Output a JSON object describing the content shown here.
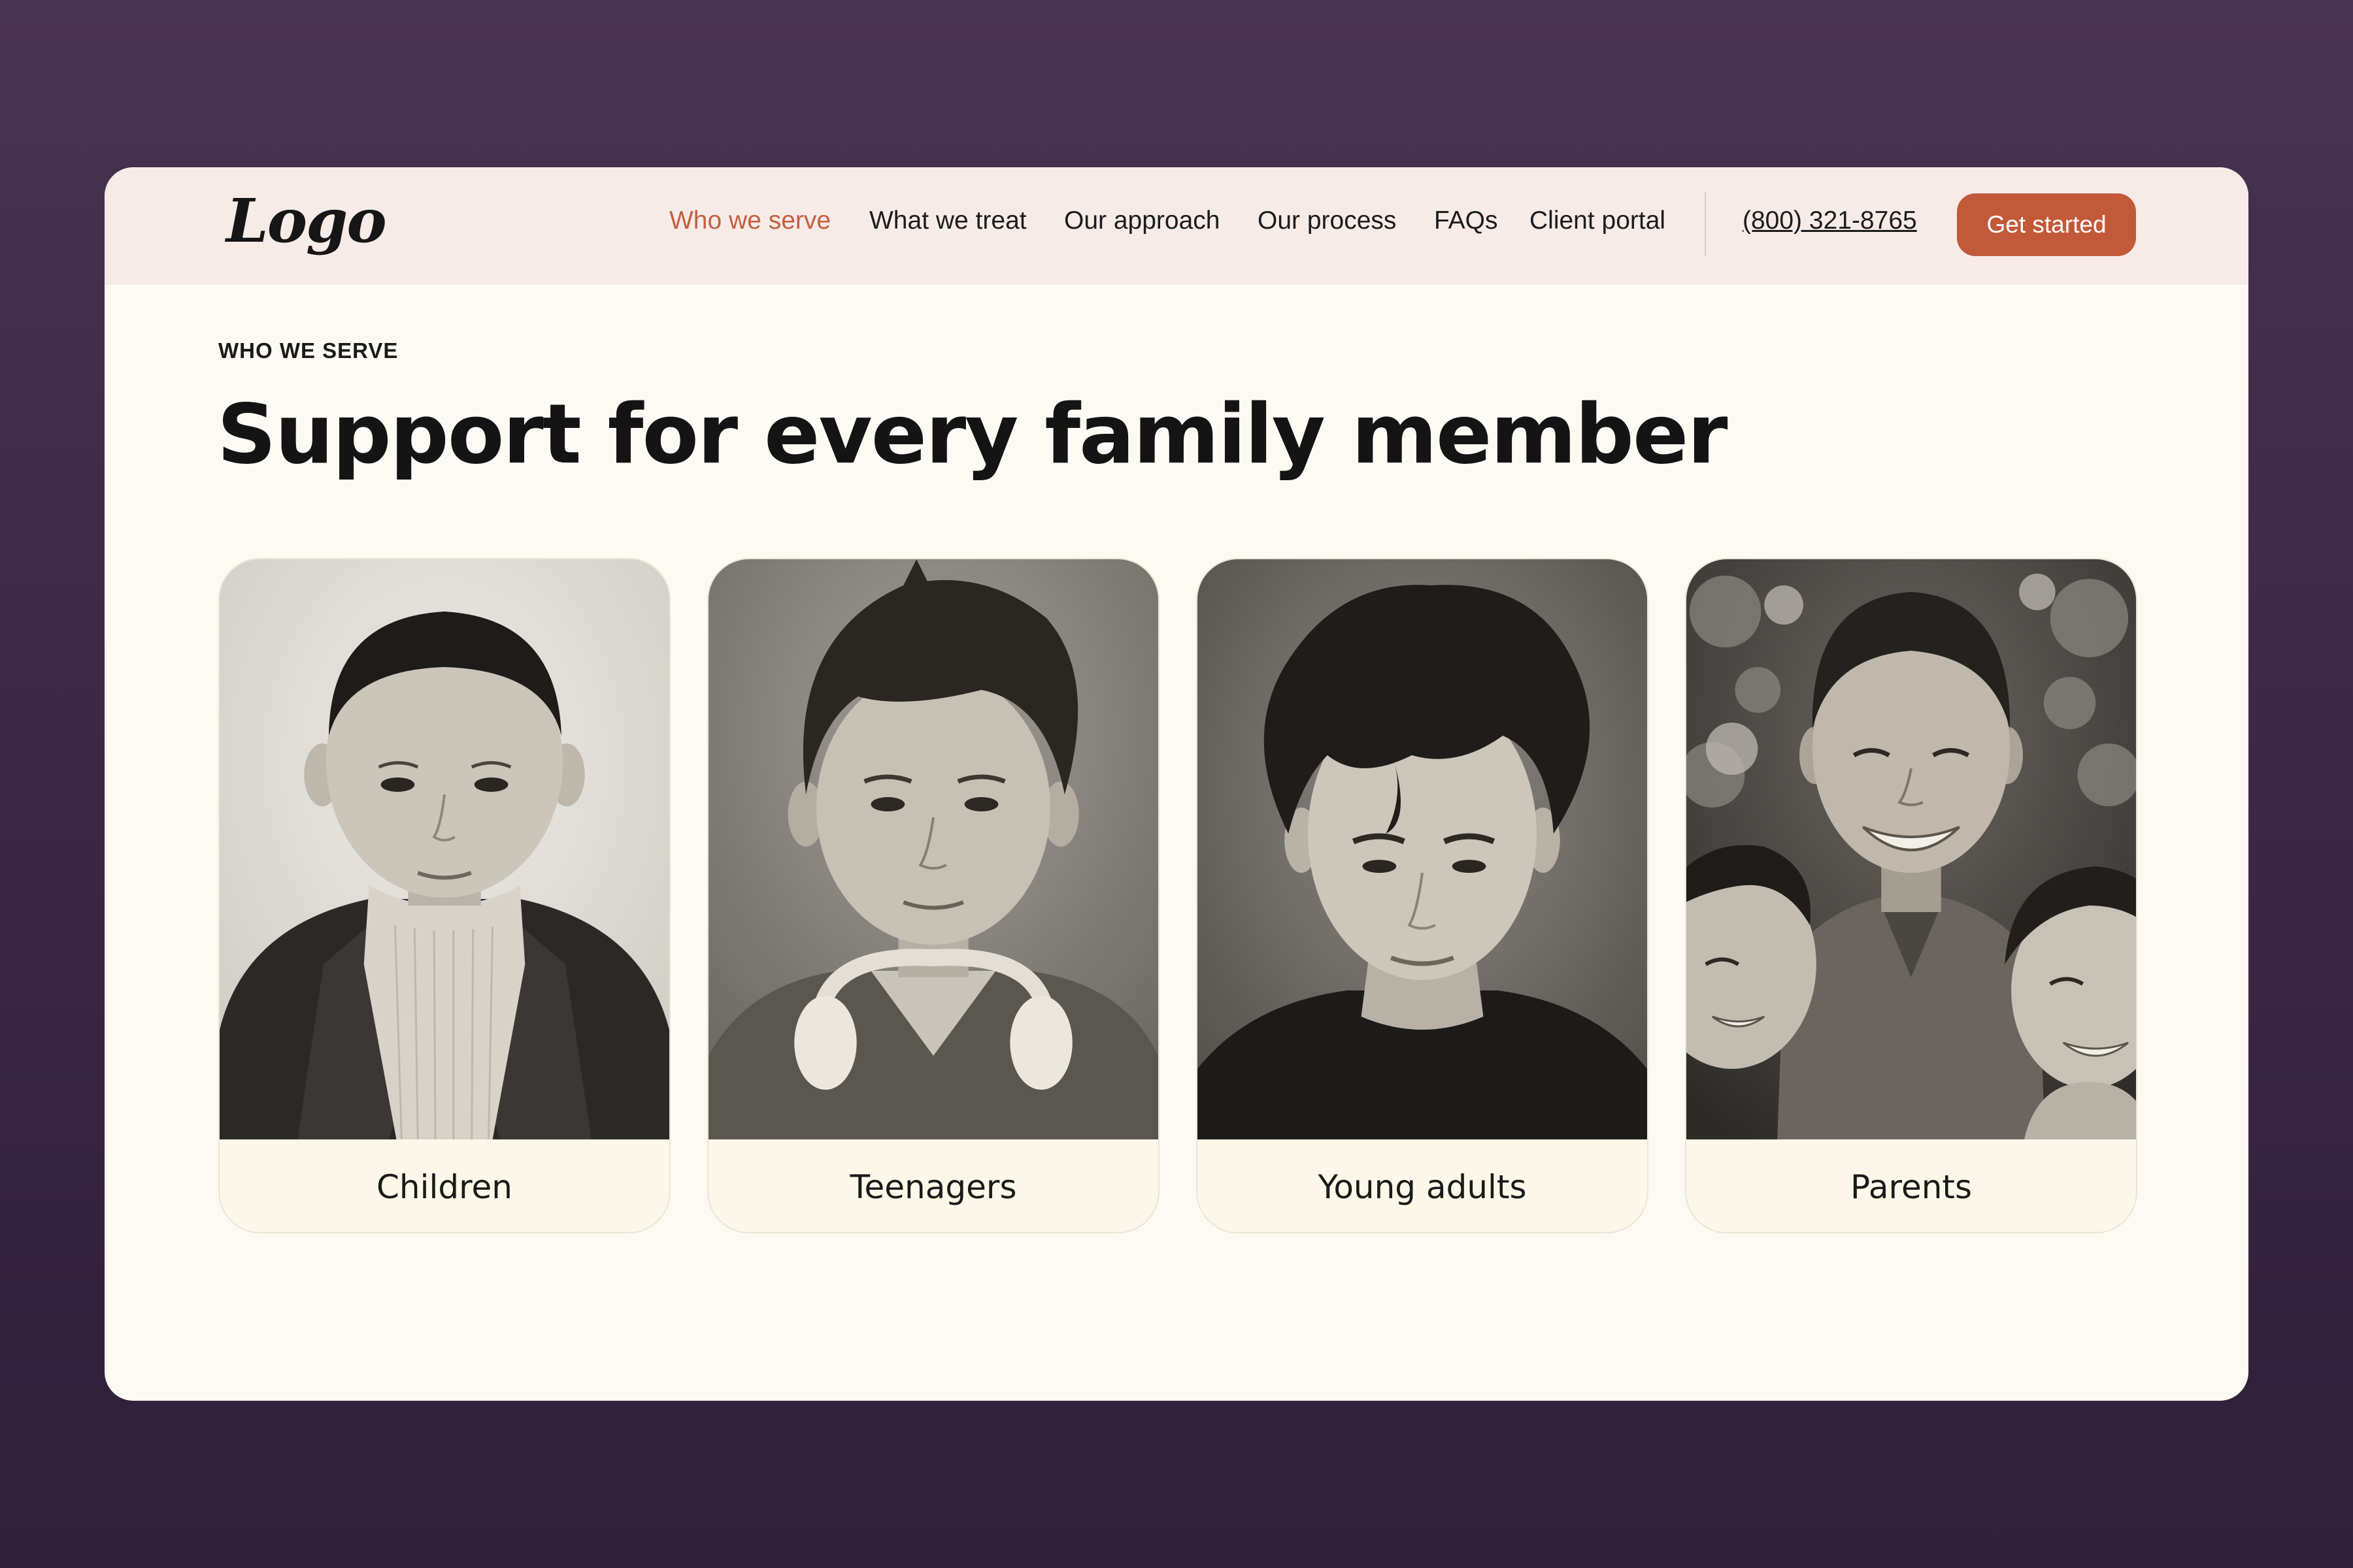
{
  "header": {
    "logo_text": "Logo",
    "nav": [
      {
        "label": "Who we serve",
        "active": true
      },
      {
        "label": "What we treat",
        "active": false
      },
      {
        "label": "Our approach",
        "active": false
      },
      {
        "label": "Our process",
        "active": false
      },
      {
        "label": "FAQs",
        "active": false
      },
      {
        "label": "Client portal",
        "active": false
      }
    ],
    "phone": "(800) 321-8765",
    "cta_label": "Get started"
  },
  "section": {
    "eyebrow": "WHO WE SERVE",
    "title": "Support for every family member"
  },
  "cards": [
    {
      "label": "Children"
    },
    {
      "label": "Teenagers"
    },
    {
      "label": "Young adults"
    },
    {
      "label": "Parents"
    }
  ],
  "colors": {
    "accent": "#c25a3a",
    "active_link": "#c4603f",
    "header_bg": "#f7ebe8",
    "page_bg": "#fdfaf3",
    "card_label_bg": "#fcf7e8",
    "backdrop": "#3b2846"
  }
}
